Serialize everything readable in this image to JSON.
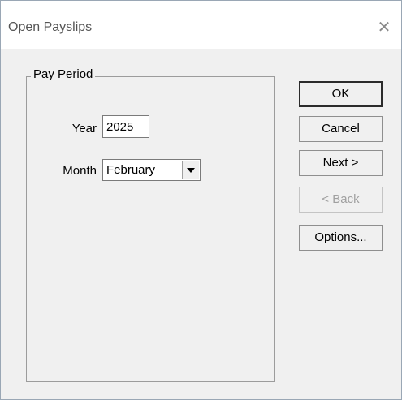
{
  "window": {
    "title": "Open Payslips",
    "close_glyph": "✕"
  },
  "pay_period": {
    "legend": "Pay Period",
    "year_label": "Year",
    "year_value": "2025",
    "month_label": "Month",
    "month_value": "February"
  },
  "buttons": {
    "ok": "OK",
    "cancel": "Cancel",
    "next": "Next >",
    "back": "< Back",
    "options": "Options..."
  },
  "state": {
    "back_disabled": true
  }
}
